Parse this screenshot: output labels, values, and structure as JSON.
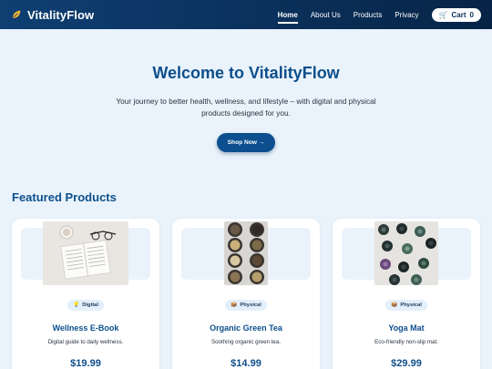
{
  "nav": {
    "brand": "VitalityFlow",
    "links": [
      "Home",
      "About Us",
      "Products",
      "Privacy"
    ],
    "cart_label": "Cart",
    "cart_count": "0"
  },
  "hero": {
    "title": "Welcome to VitalityFlow",
    "subtitle": "Your journey to better health, wellness, and lifestyle – with digital and physical products designed for you.",
    "cta": "Shop Now →"
  },
  "featured": {
    "title": "Featured Products",
    "products": [
      {
        "badge": "Digital",
        "title": "Wellness E-Book",
        "desc": "Digital guide to daily wellness.",
        "price": "$19.99"
      },
      {
        "badge": "Physical",
        "title": "Organic Green Tea",
        "desc": "Soothing organic green tea.",
        "price": "$14.99"
      },
      {
        "badge": "Physical",
        "title": "Yoga Mat",
        "desc": "Eco-friendly non-slip mat.",
        "price": "$29.99"
      }
    ]
  },
  "colors": {
    "primary": "#0d4f8b",
    "nav": "#0a2f59",
    "background": "#eaf3fb"
  }
}
